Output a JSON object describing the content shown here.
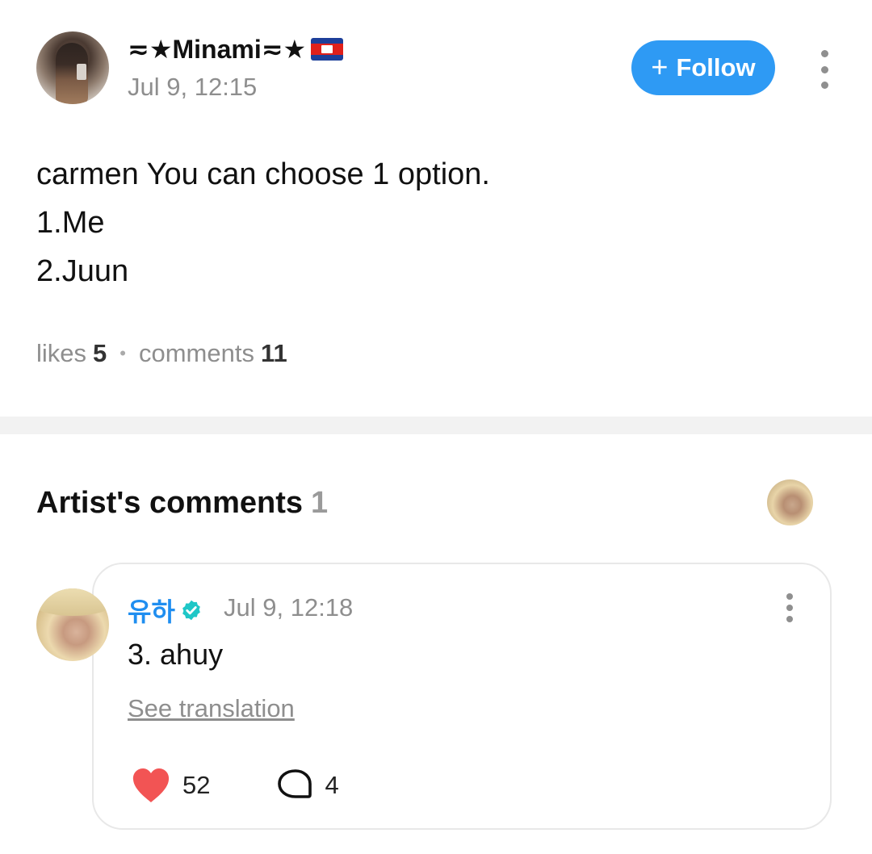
{
  "post": {
    "username_prefix": "≂★Minami≂★",
    "flag": "cambodia-flag",
    "timestamp": "Jul 9, 12:15",
    "follow_label": "Follow",
    "follow_color": "#2e9af4",
    "body_lines": [
      "carmen You can choose 1 option.",
      "1.Me",
      "2.Juun"
    ],
    "likes_label": "likes",
    "likes_count": "5",
    "comments_label": "comments",
    "comments_count": "11"
  },
  "artist_section": {
    "title": "Artist's comments",
    "count": "1"
  },
  "comment": {
    "author": "유하",
    "verified_color": "#1fc7c7",
    "timestamp": "Jul 9, 12:18",
    "text": "3. ahuy",
    "see_translation": "See translation",
    "like_count": "52",
    "like_color": "#f25454",
    "reply_count": "4"
  }
}
